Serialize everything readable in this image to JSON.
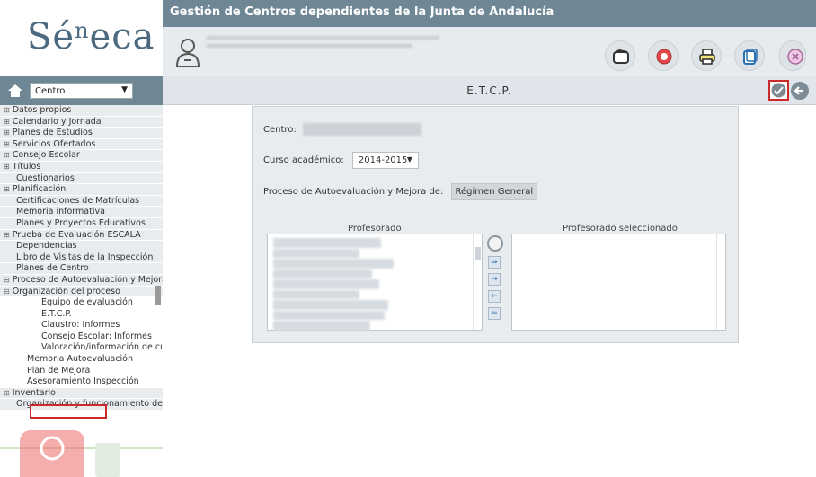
{
  "app": {
    "title": "Gestión de Centros dependientes de la Junta de Andalucía",
    "logo": "Séneca"
  },
  "header": {
    "user_icon": "user-icon",
    "buttons": [
      {
        "name": "folder-open-button",
        "icon": "folder-icon"
      },
      {
        "name": "help-button",
        "icon": "lifebuoy-icon"
      },
      {
        "name": "print-button",
        "icon": "printer-icon"
      },
      {
        "name": "copy-button",
        "icon": "window-icon"
      },
      {
        "name": "logout-button",
        "icon": "close-icon"
      }
    ]
  },
  "sidebar": {
    "selector_value": "Centro",
    "items": [
      {
        "label": "Datos propios",
        "level": 0,
        "toggle": "⊞"
      },
      {
        "label": "Calendario y Jornada",
        "level": 0,
        "toggle": "⊞"
      },
      {
        "label": "Planes de Estudios",
        "level": 0,
        "toggle": "⊞"
      },
      {
        "label": "Servicios Ofertados",
        "level": 0,
        "toggle": "⊞"
      },
      {
        "label": "Consejo Escolar",
        "level": 0,
        "toggle": "⊞"
      },
      {
        "label": "Títulos",
        "level": 0,
        "toggle": "⊞"
      },
      {
        "label": "Cuestionarios",
        "level": 1,
        "toggle": ""
      },
      {
        "label": "Planificación",
        "level": 0,
        "toggle": "⊞"
      },
      {
        "label": "Certificaciones de Matrículas",
        "level": 1,
        "toggle": ""
      },
      {
        "label": "Memoria informativa",
        "level": 1,
        "toggle": ""
      },
      {
        "label": "Planes y Proyectos Educativos",
        "level": 1,
        "toggle": ""
      },
      {
        "label": "Prueba de Evaluación ESCALA",
        "level": 0,
        "toggle": "⊞"
      },
      {
        "label": "Dependencias",
        "level": 1,
        "toggle": ""
      },
      {
        "label": "Libro de Visitas de la Inspección",
        "level": 1,
        "toggle": ""
      },
      {
        "label": "Planes de Centro",
        "level": 1,
        "toggle": ""
      },
      {
        "label": "Proceso de Autoevaluación y Mejora",
        "level": 0,
        "toggle": "⊟"
      },
      {
        "label": "Organización del proceso",
        "level": 1,
        "toggle": "⊟"
      },
      {
        "label": "Equipo de evaluación",
        "level": 3,
        "toggle": ""
      },
      {
        "label": "E.T.C.P.",
        "level": 3,
        "toggle": ""
      },
      {
        "label": "Claustro: Informes",
        "level": 3,
        "toggle": ""
      },
      {
        "label": "Consejo Escolar: Informes",
        "level": 3,
        "toggle": ""
      },
      {
        "label": "Valoración/información de cu",
        "level": 3,
        "toggle": ""
      },
      {
        "label": "Memoria Autoevaluación",
        "level": 2,
        "toggle": ""
      },
      {
        "label": "Plan de Mejora",
        "level": 2,
        "toggle": ""
      },
      {
        "label": "Asesoramiento Inspección",
        "level": 2,
        "toggle": ""
      },
      {
        "label": "Inventario",
        "level": 0,
        "toggle": "⊞"
      },
      {
        "label": "Organización y funcionamiento de",
        "level": 1,
        "toggle": ""
      }
    ]
  },
  "main": {
    "page_title": "E.T.C.P.",
    "centro_label": "Centro:",
    "curso_label": "Curso académico:",
    "curso_value": "2014-2015",
    "proceso_label": "Proceso de Autoevaluación y Mejora de:",
    "proceso_value": "Régimen General",
    "profesorado_label": "Profesorado",
    "seleccionado_label": "Profesorado seleccionado",
    "transfer_buttons": [
      "⇛",
      "→",
      "←",
      "⇚"
    ]
  }
}
